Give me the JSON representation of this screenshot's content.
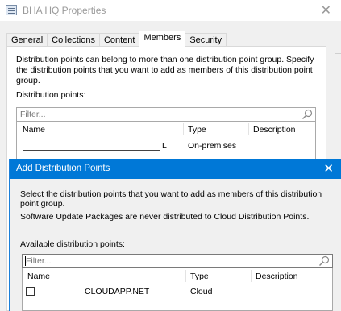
{
  "window": {
    "title": "BHA HQ Properties",
    "close_glyph": "✕"
  },
  "tabs": [
    {
      "label": "General",
      "active": false
    },
    {
      "label": "Collections",
      "active": false
    },
    {
      "label": "Content",
      "active": false
    },
    {
      "label": "Members",
      "active": true
    },
    {
      "label": "Security",
      "active": false
    }
  ],
  "members": {
    "description": "Distribution points can belong to more than one distribution point group. Specify the distribution points that you want to add as members of this distribution point group.",
    "list_label": "Distribution points:",
    "filter_placeholder": "Filter...",
    "columns": {
      "name": "Name",
      "type": "Type",
      "description": "Description"
    },
    "rows": [
      {
        "name_suffix": "L",
        "type": "On-premises",
        "description": ""
      }
    ]
  },
  "dialog": {
    "title": "Add Distribution Points",
    "close_glyph": "✕",
    "instruction": "Select the distribution points that you want to add as members of this distribution point group.",
    "note": "Software Update Packages are never distributed to Cloud Distribution Points.",
    "available_label": "Available distribution points:",
    "filter_placeholder": "Filter...",
    "columns": {
      "name": "Name",
      "type": "Type",
      "description": "Description"
    },
    "rows": [
      {
        "name_suffix": "CLOUDAPP.NET",
        "type": "Cloud",
        "description": "",
        "checked": false
      }
    ]
  },
  "icons": {
    "window": "properties-window-icon",
    "search": "search-icon",
    "close": "close-icon"
  },
  "colors": {
    "accent": "#0078d7",
    "title_inactive": "#9a9a9a"
  }
}
